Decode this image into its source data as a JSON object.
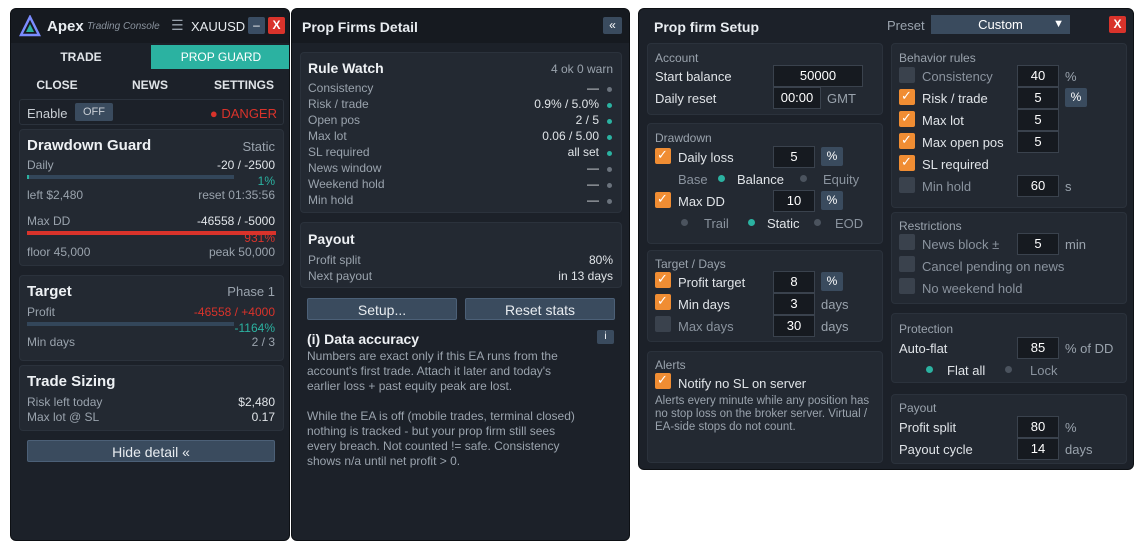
{
  "main": {
    "brand": "Apex",
    "tagline": "Trading Console",
    "menu_glyph": "☰",
    "symbol": "XAUUSD",
    "minimize": "–",
    "close": "X",
    "tabs": [
      "TRADE",
      "PROP GUARD"
    ],
    "subtabs": [
      "CLOSE",
      "NEWS",
      "SETTINGS"
    ],
    "enable_label": "Enable",
    "enable_toggle": "OFF",
    "status": "● DANGER",
    "drawdown": {
      "title": "Drawdown Guard",
      "mode": "Static",
      "daily_label": "Daily",
      "daily_value": "-20 / -2500",
      "daily_pct": "1%",
      "daily_fill": 0.01,
      "left": "left $2,480",
      "reset": "reset 01:35:56",
      "maxdd_label": "Max DD",
      "maxdd_value": "-46558 / -5000",
      "maxdd_pct": "931%",
      "maxdd_fill": 1.0,
      "floor": "floor 45,000",
      "peak": "peak 50,000"
    },
    "target": {
      "title": "Target",
      "phase": "Phase 1",
      "profit_label": "Profit",
      "profit_value": "-46558 / +4000",
      "profit_pct": "-1164%",
      "profit_fill": 0.0,
      "mindays_label": "Min days",
      "mindays_value": "2 / 3"
    },
    "sizing": {
      "title": "Trade Sizing",
      "risk_label": "Risk left today",
      "risk_value": "$2,480",
      "maxlot_label": "Max lot @ SL",
      "maxlot_value": "0.17"
    },
    "hide_btn": "Hide detail «"
  },
  "detail": {
    "title": "Prop Firms Detail",
    "collapse": "«",
    "rule_watch": {
      "title": "Rule Watch",
      "summary": "4 ok  0 warn",
      "rows": [
        {
          "label": "Consistency",
          "value": "—",
          "status": "off"
        },
        {
          "label": "Risk / trade",
          "value": "0.9% / 5.0%",
          "status": "ok"
        },
        {
          "label": "Open pos",
          "value": "2 / 5",
          "status": "ok"
        },
        {
          "label": "Max lot",
          "value": "0.06 / 5.00",
          "status": "ok"
        },
        {
          "label": "SL required",
          "value": "all set",
          "status": "ok"
        },
        {
          "label": "News window",
          "value": "—",
          "status": "off"
        },
        {
          "label": "Weekend hold",
          "value": "—",
          "status": "off"
        },
        {
          "label": "Min hold",
          "value": "—",
          "status": "off"
        }
      ]
    },
    "payout": {
      "title": "Payout",
      "split_label": "Profit split",
      "split_value": "80%",
      "next_label": "Next payout",
      "next_value": "in 13 days"
    },
    "setup_btn": "Setup...",
    "reset_btn": "Reset stats",
    "accuracy": {
      "title": "(i)  Data accuracy",
      "info": "i",
      "p1": "Numbers are exact only if this EA runs from the account's first trade. Attach it later and today's earlier loss + past equity peak are lost.",
      "p2": "While the EA is off (mobile trades, terminal closed) nothing is tracked - but your prop firm still sees every breach. Not counted != safe. Consistency shows n/a until net profit > 0."
    }
  },
  "setup": {
    "title": "Prop firm Setup",
    "preset_label": "Preset",
    "preset_value": "Custom",
    "preset_arrow": "▼",
    "close": "X",
    "account": {
      "title": "Account",
      "start_label": "Start balance",
      "start_value": "50000",
      "reset_label": "Daily reset",
      "reset_value": "00:00",
      "reset_unit": "GMT"
    },
    "drawdown": {
      "title": "Drawdown",
      "daily_label": "Daily loss",
      "daily_value": "5",
      "pct": "%",
      "base_label": "Base",
      "base_opt1": "Balance",
      "base_opt2": "Equity",
      "maxdd_label": "Max DD",
      "maxdd_value": "10",
      "mode1": "Trail",
      "mode2": "Static",
      "mode3": "EOD"
    },
    "target": {
      "title": "Target / Days",
      "profit_label": "Profit target",
      "profit_value": "8",
      "mindays_label": "Min days",
      "mindays_value": "3",
      "maxdays_label": "Max days",
      "maxdays_value": "30",
      "days_unit": "days"
    },
    "alerts": {
      "title": "Alerts",
      "notify_label": "Notify no SL on server",
      "desc": "Alerts every minute while any position has no stop loss on the broker server. Virtual / EA-side stops do not count."
    },
    "behavior": {
      "title": "Behavior rules",
      "consistency_label": "Consistency",
      "consistency_value": "40",
      "risk_label": "Risk / trade",
      "risk_value": "5",
      "maxlot_label": "Max lot",
      "maxlot_value": "5",
      "maxopen_label": "Max open pos",
      "maxopen_value": "5",
      "sl_label": "SL required",
      "minhold_label": "Min hold",
      "minhold_value": "60",
      "sec_unit": "s"
    },
    "restrictions": {
      "title": "Restrictions",
      "news_label": "News block ±",
      "news_value": "5",
      "news_unit": "min",
      "cancel_label": "Cancel pending on news",
      "weekend_label": "No weekend hold"
    },
    "protection": {
      "title": "Protection",
      "autoflat_label": "Auto-flat",
      "autoflat_value": "85",
      "autoflat_unit": "% of DD",
      "opt1": "Flat all",
      "opt2": "Lock"
    },
    "payout": {
      "title": "Payout",
      "split_label": "Profit split",
      "split_value": "80",
      "cycle_label": "Payout cycle",
      "cycle_value": "14",
      "days_unit": "days"
    }
  },
  "colors": {
    "accent": "#2bb2a1",
    "danger": "#d9332b",
    "warning": "#f08d33"
  }
}
